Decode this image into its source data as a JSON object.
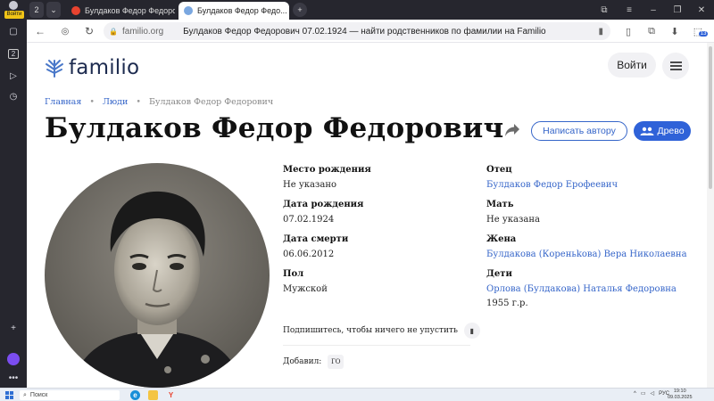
{
  "browser": {
    "login_label": "Войти",
    "tab_count": "2",
    "tabs": [
      {
        "title": "Булдаков Федор Федорович",
        "active": false
      },
      {
        "title": "Булдаков Федор Федо...",
        "active": true
      }
    ],
    "url_domain": "familio.org",
    "page_title": "Булдаков Федор Федорович 07.02.1924 — найти родственников по фамилии на Familio",
    "ext_badge": "13"
  },
  "header": {
    "logo": "familio",
    "login_button": "Войти"
  },
  "breadcrumbs": [
    "Главная",
    "Люди",
    "Булдаков Федор Федорович"
  ],
  "person": {
    "name": "Булдаков Федор Федорович",
    "write_author_button": "Написать автору",
    "tree_button": "Древо"
  },
  "details": {
    "birth_place_label": "Место рождения",
    "birth_place": "Не указано",
    "birth_date_label": "Дата рождения",
    "birth_date": "07.02.1924",
    "death_date_label": "Дата смерти",
    "death_date": "06.06.2012",
    "sex_label": "Пол",
    "sex": "Мужской"
  },
  "relatives": {
    "father_label": "Отец",
    "father": "Булдаков Федор Ерофеевич",
    "mother_label": "Мать",
    "mother": "Не указана",
    "wife_label": "Жена",
    "wife": "Булдакова (Кореньkова) Вера Николаевна",
    "children_label": "Дети",
    "child_name": "Орлова (Булдакова) Наталья Федоровна",
    "child_year": "1955 г.р."
  },
  "subscribe_text": "Подпишитесь, чтобы ничего не упустить",
  "added_label": "Добавил:",
  "added_by": "ГО",
  "taskbar": {
    "search_placeholder": "Поиск",
    "lang": "РУС",
    "time": "19:10",
    "date": "09.03.2025"
  },
  "colors": {
    "accent": "#2f62d8",
    "link": "#3565c9",
    "browser_dark": "#26262e"
  }
}
